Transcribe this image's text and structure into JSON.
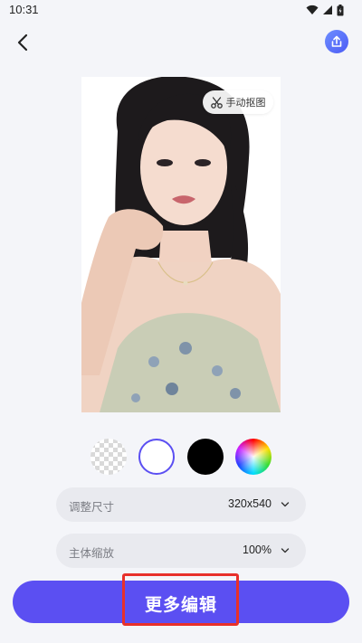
{
  "status_bar": {
    "time": "10:31",
    "icons": [
      "wifi-icon",
      "signal-icon",
      "battery-icon"
    ]
  },
  "header": {
    "back_icon": "back-arrow-icon",
    "share_icon": "share-icon",
    "share_color": "#4c5cf5"
  },
  "photo": {
    "subject": "portrait of a woman with dark hair wearing a floral halter top on a white background",
    "background_color": "#ffffff"
  },
  "manual_cutout": {
    "label": "手动抠图",
    "icon": "scissors-icon"
  },
  "background_swatches": [
    {
      "name": "transparent",
      "selected": false
    },
    {
      "name": "white",
      "color": "#ffffff",
      "selected": true
    },
    {
      "name": "black",
      "color": "#000000",
      "selected": false
    },
    {
      "name": "custom",
      "icon": "color-wheel-icon",
      "selected": false
    }
  ],
  "options": {
    "size": {
      "label": "调整尺寸",
      "value": "320x540"
    },
    "scale": {
      "label": "主体缩放",
      "value": "100%"
    }
  },
  "primary_button": {
    "label": "更多编辑",
    "color": "#5b4ff2"
  },
  "highlight_color": "#e8302a"
}
